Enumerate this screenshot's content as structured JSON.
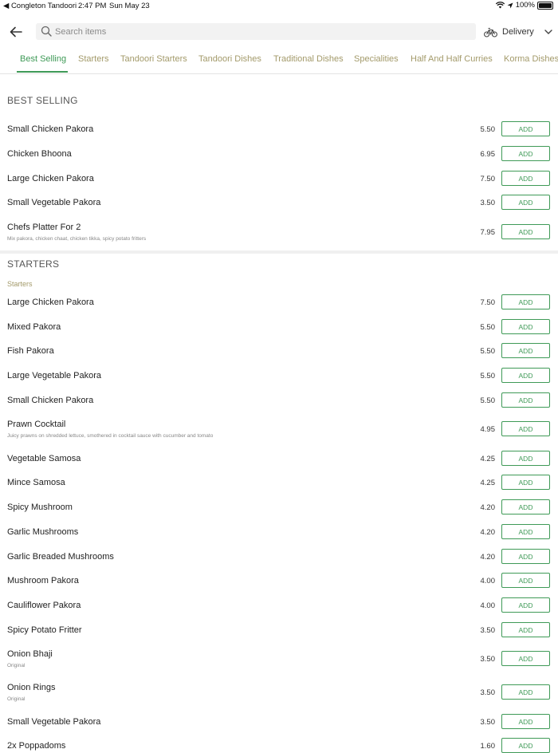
{
  "status_bar": {
    "back_app": "◀ Congleton Tandoori",
    "time": "2:47 PM",
    "date": "Sun May 23",
    "battery": "100%"
  },
  "search": {
    "placeholder": "Search items"
  },
  "delivery": {
    "label": "Delivery"
  },
  "tabs": [
    "Best Selling",
    "Starters",
    "Tandoori Starters",
    "Tandoori Dishes",
    "Traditional Dishes",
    "Specialities",
    "Half And Half Curries",
    "Korma Dishes"
  ],
  "active_tab": "Best Selling",
  "accent_color": "#3f9a57",
  "add_label": "ADD",
  "sections": [
    {
      "title": "BEST SELLING",
      "subheading": "",
      "items": [
        {
          "name": "Small Chicken Pakora",
          "price": "5.50",
          "desc": ""
        },
        {
          "name": "Chicken Bhoona",
          "price": "6.95",
          "desc": ""
        },
        {
          "name": "Large Chicken Pakora",
          "price": "7.50",
          "desc": ""
        },
        {
          "name": "Small Vegetable Pakora",
          "price": "3.50",
          "desc": ""
        },
        {
          "name": "Chefs Platter For 2",
          "price": "7.95",
          "desc": "Mix pakora, chicken chaat, chicken tikka, spicy potato fritters"
        }
      ]
    },
    {
      "title": "STARTERS",
      "subheading": "Starters",
      "items": [
        {
          "name": "Large Chicken Pakora",
          "price": "7.50",
          "desc": ""
        },
        {
          "name": "Mixed Pakora",
          "price": "5.50",
          "desc": ""
        },
        {
          "name": "Fish Pakora",
          "price": "5.50",
          "desc": ""
        },
        {
          "name": "Large Vegetable Pakora",
          "price": "5.50",
          "desc": ""
        },
        {
          "name": "Small Chicken Pakora",
          "price": "5.50",
          "desc": ""
        },
        {
          "name": "Prawn Cocktail",
          "price": "4.95",
          "desc": "Juicy prawns on shredded lettuce, smothered in cocktail sauce with cucumber and tomato"
        },
        {
          "name": "Vegetable Samosa",
          "price": "4.25",
          "desc": ""
        },
        {
          "name": "Mince Samosa",
          "price": "4.25",
          "desc": ""
        },
        {
          "name": "Spicy Mushroom",
          "price": "4.20",
          "desc": ""
        },
        {
          "name": "Garlic Mushrooms",
          "price": "4.20",
          "desc": ""
        },
        {
          "name": "Garlic Breaded Mushrooms",
          "price": "4.20",
          "desc": ""
        },
        {
          "name": "Mushroom Pakora",
          "price": "4.00",
          "desc": ""
        },
        {
          "name": "Cauliflower Pakora",
          "price": "4.00",
          "desc": ""
        },
        {
          "name": "Spicy Potato Fritter",
          "price": "3.50",
          "desc": ""
        },
        {
          "name": "Onion Bhaji",
          "price": "3.50",
          "desc": "Original"
        },
        {
          "name": "Onion Rings",
          "price": "3.50",
          "desc": "Original"
        },
        {
          "name": "Small Vegetable Pakora",
          "price": "3.50",
          "desc": ""
        },
        {
          "name": "2x Poppadoms",
          "price": "1.60",
          "desc": ""
        }
      ]
    }
  ]
}
